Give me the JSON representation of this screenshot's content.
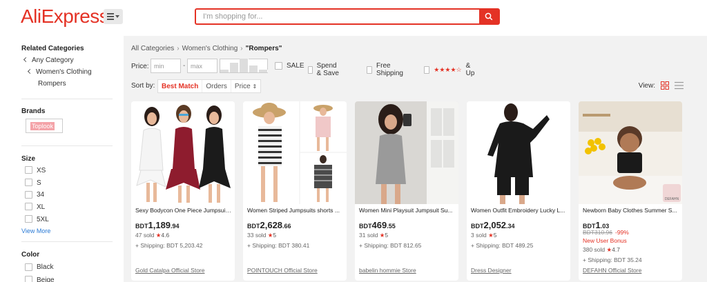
{
  "header": {
    "logo": "AliExpress",
    "search_placeholder": "I'm shopping for..."
  },
  "sidebar": {
    "related_title": "Related Categories",
    "categories": [
      "Any Category",
      "Women's Clothing",
      "Rompers"
    ],
    "brands_title": "Brands",
    "brand": "Toplook",
    "size_title": "Size",
    "sizes": [
      "XS",
      "S",
      "34",
      "XL",
      "5XL"
    ],
    "view_more": "View More",
    "color_title": "Color",
    "colors": [
      "Black",
      "Beige"
    ]
  },
  "breadcrumb": {
    "items": [
      "All Categories",
      "Women's Clothing"
    ],
    "current": "\"Rompers\""
  },
  "filters": {
    "price_label": "Price:",
    "min_placeholder": "min",
    "max_placeholder": "max",
    "dash": "-",
    "sale": "SALE",
    "spend_save": "Spend & Save",
    "free_shipping": "Free Shipping",
    "stars": "★★★★☆",
    "and_up": "& Up"
  },
  "sort": {
    "label": "Sort by:",
    "options": [
      "Best Match",
      "Orders",
      "Price"
    ],
    "view_label": "View:"
  },
  "products": [
    {
      "title": "Sexy Bodycon One Piece Jumpsuit ...",
      "currency": "BDT",
      "price_main": "1,189",
      "price_cents": ".94",
      "sold": "47 sold",
      "rating": "4.6",
      "shipping": "+ Shipping: BDT 5,203.42",
      "store": "Gold Catalpa Official Store"
    },
    {
      "title": "Women Striped Jumpsuits shorts ...",
      "currency": "BDT",
      "price_main": "2,628",
      "price_cents": ".66",
      "sold": "33 sold",
      "rating": "5",
      "shipping": "+ Shipping: BDT 380.41",
      "store": "POINTOUCH Official Store"
    },
    {
      "title": "Women Mini Playsuit Jumpsuit Su...",
      "currency": "BDT",
      "price_main": "469",
      "price_cents": ".55",
      "sold": "31 sold",
      "rating": "5",
      "shipping": "+ Shipping: BDT 812.65",
      "store": "babelin hommie Store"
    },
    {
      "title": "Women Outfit Embroidery Lucky L...",
      "currency": "BDT",
      "price_main": "2,052",
      "price_cents": ".34",
      "sold": "3 sold",
      "rating": "5",
      "shipping": "+ Shipping: BDT 489.25",
      "store": "Dress Designer"
    },
    {
      "title": "Newborn Baby Clothes Summer S...",
      "currency": "BDT",
      "price_main": "1",
      "price_cents": ".03",
      "original_price": "BDT310.96",
      "discount": "-99%",
      "bonus": "New User Bonus",
      "sold": "380 sold",
      "rating": "4.7",
      "shipping": "+ Shipping: BDT 35.24",
      "store": "DEFAHN Official Store",
      "watermark": "DEFAHN"
    }
  ],
  "colors": {
    "accent": "#e43225",
    "link": "#2a7ad5"
  }
}
